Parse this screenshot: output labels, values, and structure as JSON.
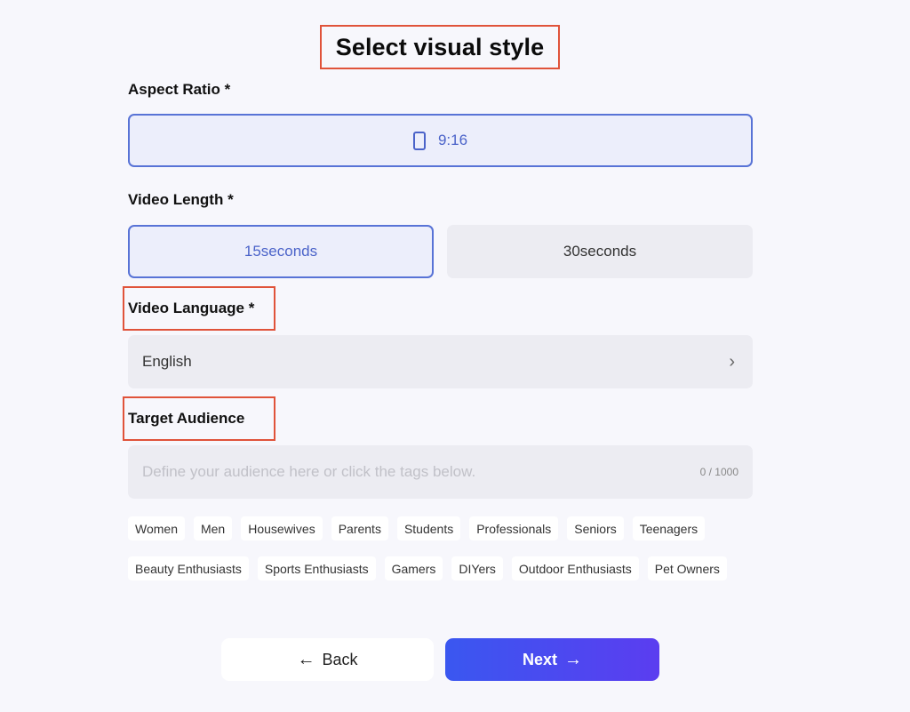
{
  "header": {
    "title": "Select visual style"
  },
  "aspect_ratio": {
    "label": "Aspect Ratio *",
    "selected": "9:16",
    "icon": "portrait-phone-icon"
  },
  "video_length": {
    "label": "Video Length *",
    "options": [
      {
        "label": "15seconds",
        "selected": true
      },
      {
        "label": "30seconds",
        "selected": false
      }
    ]
  },
  "video_language": {
    "label": "Video Language *",
    "value": "English",
    "icon": "chevron-right-icon"
  },
  "target_audience": {
    "label": "Target Audience",
    "placeholder": "Define your audience here or click the tags below.",
    "value": "",
    "counter": "0 / 1000",
    "tags_row1": [
      "Women",
      "Men",
      "Housewives",
      "Parents",
      "Students",
      "Professionals",
      "Seniors",
      "Teenagers"
    ],
    "tags_row2": [
      "Beauty Enthusiasts",
      "Sports Enthusiasts",
      "Gamers",
      "DIYers",
      "Outdoor Enthusiasts",
      "Pet Owners"
    ]
  },
  "footer": {
    "back_label": "Back",
    "next_label": "Next",
    "back_icon": "←",
    "next_icon": "→"
  },
  "colors": {
    "accent": "#5873d6",
    "highlight_box": "#e0533a",
    "next_gradient_start": "#3a57f0",
    "next_gradient_end": "#5b3df0"
  }
}
